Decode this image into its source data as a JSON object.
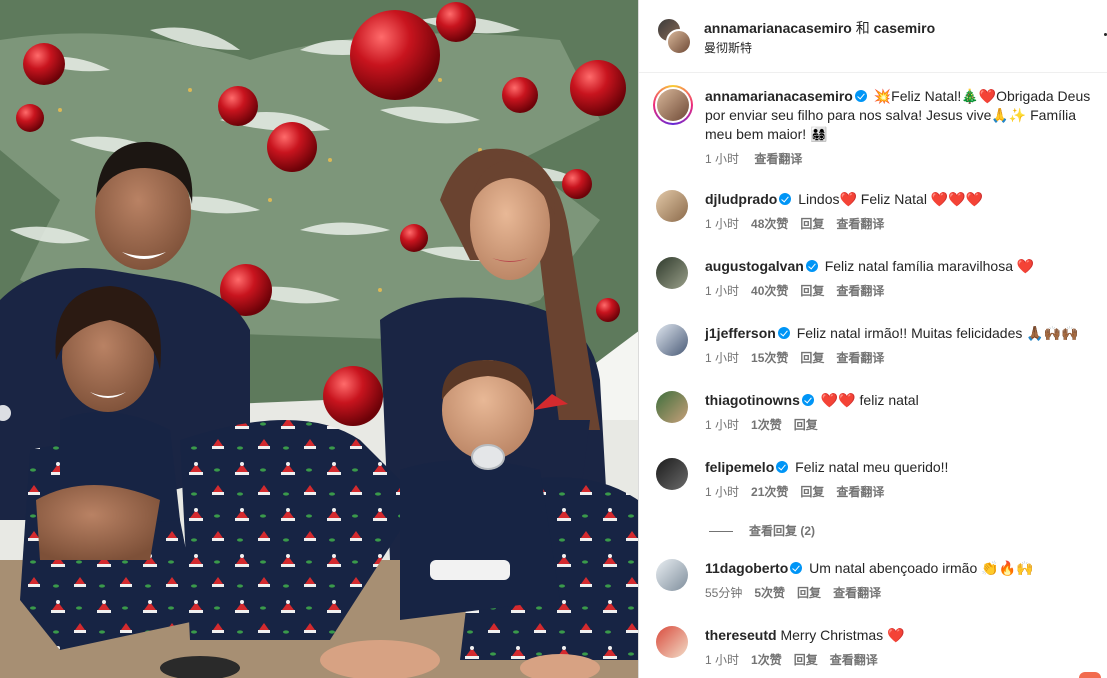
{
  "post": {
    "title_user": "annamarianacasemiro",
    "title_joiner": " 和 ",
    "title_collab": "casemiro",
    "location": "曼彻斯特"
  },
  "caption": {
    "username": "annamarianacasemiro",
    "text_a": "💥Feliz Natal!🎄",
    "text_b": "Obrigada Deus por enviar seu filho para nos salva! Jesus vive🙏✨ Família meu bem maior! 👨‍👩‍👧‍👦",
    "time": "1 小时",
    "translate": "查看翻译"
  },
  "comments": [
    {
      "username": "djludprado",
      "verified": true,
      "text": "Lindos❤️ Feliz Natal ❤️❤️❤️",
      "time": "1 小时",
      "likes": "48次赞",
      "reply": "回复",
      "translate": "查看翻译"
    },
    {
      "username": "augustogalvan",
      "verified": true,
      "text": "Feliz natal família maravilhosa ❤️",
      "time": "1 小时",
      "likes": "40次赞",
      "reply": "回复",
      "translate": "查看翻译"
    },
    {
      "username": "j1jefferson",
      "verified": true,
      "text": "Feliz natal irmão!! Muitas felicidades 🙏🏾🙌🏾🙌🏾",
      "time": "1 小时",
      "likes": "15次赞",
      "reply": "回复",
      "translate": "查看翻译"
    },
    {
      "username": "thiagotinowns",
      "verified": true,
      "text": "❤️❤️ feliz natal",
      "time": "1 小时",
      "likes": "1次赞",
      "reply": "回复",
      "translate": ""
    },
    {
      "username": "felipemelo",
      "verified": true,
      "text": "Feliz natal meu querido!!",
      "time": "1 小时",
      "likes": "21次赞",
      "reply": "回复",
      "translate": "查看翻译"
    },
    {
      "username": "11dagoberto",
      "verified": true,
      "text": "Um natal abençoado irmão 👏🔥🙌",
      "time": "55分钟",
      "likes": "5次赞",
      "reply": "回复",
      "translate": "查看翻译"
    },
    {
      "username": "thereseutd",
      "verified": false,
      "text": "Merry Christmas ❤️",
      "time": "1 小时",
      "likes": "1次赞",
      "reply": "回复",
      "translate": "查看翻译"
    }
  ],
  "view_replies": "查看回复 (2)",
  "colors": {
    "verified": "#0095f6",
    "meta": "#737373",
    "heart": "#e0202b"
  }
}
